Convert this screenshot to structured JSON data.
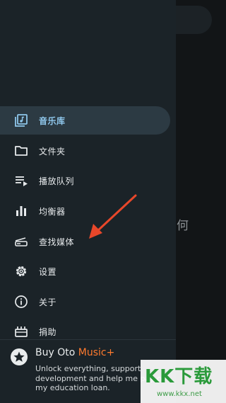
{
  "background": {
    "partial_text": "何"
  },
  "drawer": {
    "items": [
      {
        "label": "音乐库",
        "icon": "library-music-icon",
        "active": true
      },
      {
        "label": "文件夹",
        "icon": "folder-icon",
        "active": false
      },
      {
        "label": "播放队列",
        "icon": "queue-icon",
        "active": false
      },
      {
        "label": "均衡器",
        "icon": "equalizer-icon",
        "active": false
      },
      {
        "label": "查找媒体",
        "icon": "scanner-icon",
        "active": false
      },
      {
        "label": "设置",
        "icon": "gear-icon",
        "active": false
      },
      {
        "label": "关于",
        "icon": "info-icon",
        "active": false
      },
      {
        "label": "捐助",
        "icon": "donate-icon",
        "active": false
      }
    ],
    "promo": {
      "title_plain": "Buy Oto ",
      "title_accent": "Music+",
      "description": "Unlock everything, support development and help me pay off my education loan."
    }
  },
  "watermark": {
    "logo": "KK下载",
    "url": "www.kkx.net"
  },
  "colors": {
    "accent": "#8fc7ec",
    "promo_accent": "#ff7a2e",
    "annotation_arrow": "#e8472a",
    "drawer_bg": "#1b2328"
  }
}
